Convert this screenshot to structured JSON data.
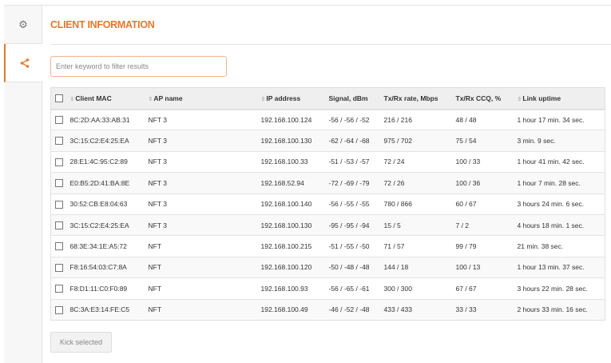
{
  "title": "CLIENT INFORMATION",
  "filter": {
    "placeholder": "Enter keyword to filter results",
    "value": ""
  },
  "columns": [
    "Client MAC",
    "AP name",
    "IP address",
    "Signal, dBm",
    "Tx/Rx rate, Mbps",
    "Tx/Rx CCQ, %",
    "Link uptime"
  ],
  "rows": [
    [
      "8C:2D:AA:33:AB:31",
      "NFT 3",
      "192.168.100.124",
      "-56 / -56 / -52",
      "216 / 216",
      "48 / 48",
      "1 hour 17 min. 34 sec."
    ],
    [
      "3C:15:C2:E4:25:EA",
      "NFT 3",
      "192.168.100.130",
      "-62 / -64 / -68",
      "975 / 702",
      "75 / 54",
      "3 min. 9 sec."
    ],
    [
      "28:E1:4C:95:C2:89",
      "NFT 3",
      "192.168.100.33",
      "-51 / -53 / -57",
      "72 / 24",
      "100 / 33",
      "1 hour 41 min. 42 sec."
    ],
    [
      "E0:B5:2D:41:BA:8E",
      "NFT 3",
      "192.168.52.94",
      "-72 / -69 / -79",
      "72 / 26",
      "100 / 36",
      "1 hour 7 min. 28 sec."
    ],
    [
      "30:52:CB:E8:04:63",
      "NFT 3",
      "192.168.100.140",
      "-56 / -55 / -55",
      "780 / 866",
      "60 / 67",
      "3 hours 24 min. 6 sec."
    ],
    [
      "3C:15:C2:E4:25:EA",
      "NFT 3",
      "192.168.100.130",
      "-95 / -95 / -94",
      "15 / 5",
      "7 / 2",
      "4 hours 18 min. 1 sec."
    ],
    [
      "68:3E:34:1E:A5:72",
      "NFT",
      "192.168.100.215",
      "-51 / -55 / -50",
      "71 / 57",
      "99 / 79",
      "21 min. 38 sec."
    ],
    [
      "F8:16:54:03:C7:8A",
      "NFT",
      "192.168.100.120",
      "-50 / -48 / -48",
      "144 / 18",
      "100 / 13",
      "1 hour 13 min. 37 sec."
    ],
    [
      "F8:D1:11:C0:F0:89",
      "NFT",
      "192.168.100.93",
      "-56 / -65 / -61",
      "300 / 300",
      "67 / 67",
      "3 hours 22 min. 28 sec."
    ],
    [
      "8C:3A:E3:14:FE:C5",
      "NFT",
      "192.168.100.49",
      "-46 / -52 / -48",
      "433 / 433",
      "33 / 33",
      "2 hours 33 min. 16 sec."
    ]
  ],
  "kick_button": "Kick selected",
  "accent": "#e8762c"
}
